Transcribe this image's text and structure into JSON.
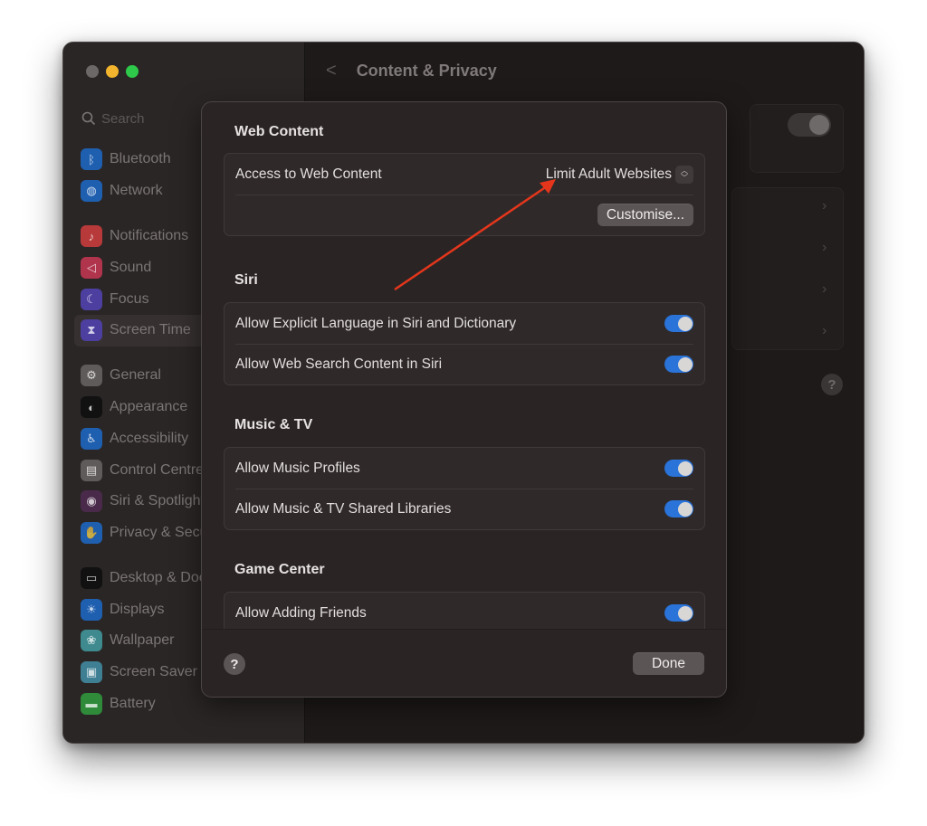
{
  "window": {
    "traffic_lights": [
      "close",
      "minimize",
      "maximize"
    ],
    "colors": {
      "close": "#6b6867",
      "minimize": "#f3b52d",
      "maximize": "#2ec94a"
    }
  },
  "sidebar": {
    "search": {
      "placeholder": "Search",
      "icon": "search-icon"
    },
    "groups": [
      [
        {
          "label": "Bluetooth",
          "icon": "bluetooth-icon",
          "color": "#1f5fb0",
          "glyph": "ᛒ"
        },
        {
          "label": "Network",
          "icon": "globe-icon",
          "color": "#1f5fb0",
          "glyph": "◍"
        }
      ],
      [
        {
          "label": "Notifications",
          "icon": "bell-icon",
          "color": "#b8393a",
          "glyph": "♪"
        },
        {
          "label": "Sound",
          "icon": "speaker-icon",
          "color": "#b0344c",
          "glyph": "◁"
        },
        {
          "label": "Focus",
          "icon": "moon-icon",
          "color": "#4d3fa0",
          "glyph": "☾"
        },
        {
          "label": "Screen Time",
          "icon": "hourglass-icon",
          "color": "#4d3fa0",
          "glyph": "⧗",
          "active": true
        }
      ],
      [
        {
          "label": "General",
          "icon": "gear-icon",
          "color": "#5f5b5a",
          "glyph": "⚙"
        },
        {
          "label": "Appearance",
          "icon": "appearance-icon",
          "color": "#111111",
          "glyph": "◐"
        },
        {
          "label": "Accessibility",
          "icon": "accessibility-icon",
          "color": "#1f5fb0",
          "glyph": "♿"
        },
        {
          "label": "Control Centre",
          "icon": "control-centre-icon",
          "color": "#5f5b5a",
          "glyph": "▤"
        },
        {
          "label": "Siri & Spotlight",
          "icon": "siri-icon",
          "color": "#4a2a4a",
          "glyph": "◉"
        },
        {
          "label": "Privacy & Security",
          "icon": "hand-icon",
          "color": "#1f5fb0",
          "glyph": "✋"
        }
      ],
      [
        {
          "label": "Desktop & Dock",
          "icon": "dock-icon",
          "color": "#111111",
          "glyph": "▭"
        },
        {
          "label": "Displays",
          "icon": "sun-icon",
          "color": "#1f5fb0",
          "glyph": "☀"
        },
        {
          "label": "Wallpaper",
          "icon": "wallpaper-icon",
          "color": "#3f8a8e",
          "glyph": "❀"
        },
        {
          "label": "Screen Saver",
          "icon": "screen-saver-icon",
          "color": "#3f7f93",
          "glyph": "▣"
        },
        {
          "label": "Battery",
          "icon": "battery-icon",
          "color": "#2f8a3a",
          "glyph": "▬"
        }
      ]
    ]
  },
  "main": {
    "back_label": "<",
    "title": "Content & Privacy",
    "help_label": "?"
  },
  "dialog": {
    "sections": [
      {
        "title": "Web Content",
        "rows": [
          {
            "label": "Access to Web Content",
            "type": "popup",
            "value": "Limit Adult Websites"
          },
          {
            "type": "button",
            "button_label": "Customise..."
          }
        ]
      },
      {
        "title": "Siri",
        "rows": [
          {
            "label": "Allow Explicit Language in Siri and Dictionary",
            "type": "toggle",
            "on": true
          },
          {
            "label": "Allow Web Search Content in Siri",
            "type": "toggle",
            "on": true
          }
        ]
      },
      {
        "title": "Music & TV",
        "rows": [
          {
            "label": "Allow Music Profiles",
            "type": "toggle",
            "on": true
          },
          {
            "label": "Allow Music & TV Shared Libraries",
            "type": "toggle",
            "on": true
          }
        ]
      },
      {
        "title": "Game Center",
        "rows": [
          {
            "label": "Allow Adding Friends",
            "type": "toggle",
            "on": true
          }
        ]
      }
    ],
    "footer": {
      "help_label": "?",
      "done_label": "Done"
    },
    "accent_color": "#2a73d9"
  },
  "annotation": {
    "type": "arrow",
    "color": "#e5361c",
    "points_to": "Limit Adult Websites"
  }
}
